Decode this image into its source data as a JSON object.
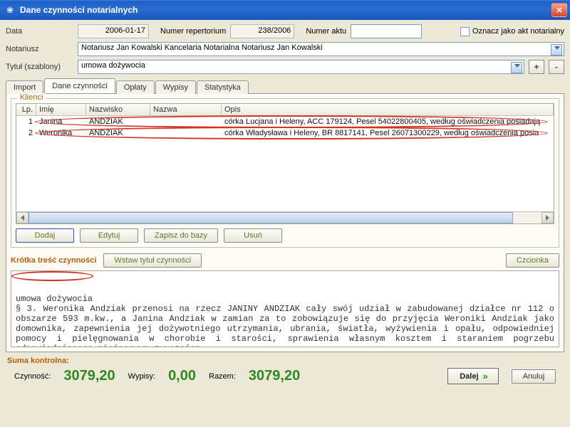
{
  "window": {
    "title": "Dane czynności notarialnych"
  },
  "labels": {
    "data": "Data",
    "numer_repertorium": "Numer repertorium",
    "numer_aktu": "Numer aktu",
    "oznacz_akt": "Oznacz jako akt notarialny",
    "notariusz": "Notariusz",
    "tytul": "Tytuł (szablony)",
    "plus": "+",
    "minus": "-"
  },
  "values": {
    "data": "2006-01-17",
    "numer_repertorium": "238/2006",
    "numer_aktu": "",
    "notariusz": "Notariusz Jan Kowalski Kancelaria Notarialna Notariusz Jan Kowalski",
    "tytul": "umowa dożywocia"
  },
  "tabs": {
    "import": "Import",
    "dane": "Dane czynności",
    "oplaty": "Opłaty",
    "wypisy": "Wypisy",
    "statystyka": "Statystyka"
  },
  "klienci": {
    "title": "Klienci",
    "headers": {
      "lp": "Lp.",
      "imie": "Imię",
      "nazwisko": "Nazwisko",
      "nazwa": "Nazwa",
      "opis": "Opis"
    },
    "rows": [
      {
        "lp": "1",
        "imie": "Janina",
        "nazwisko": "ANDZIAK",
        "nazwa": "",
        "opis": "córka Lucjana i Heleny, ACC 179124, Pesel 54022800405, według oświadczenia posiadają"
      },
      {
        "lp": "2",
        "imie": "Weronika",
        "nazwisko": "ANDZIAK",
        "nazwa": "",
        "opis": "córka Władysława i Heleny, BR 8817141, Pesel 26071300229, według oświadczenia posia"
      }
    ],
    "buttons": {
      "dodaj": "Dodaj",
      "edytuj": "Edytuj",
      "zapisz": "Zapisz do bazy",
      "usun": "Usuń"
    }
  },
  "tresc": {
    "title": "Krótka treść czynności",
    "wstaw": "Wstaw tytuł czynności",
    "czcionka": "Czcionka",
    "text": "umowa dożywocia\n§ 3. Weronika Andziak przenosi na rzecz JANINY ANDZIAK cały swój udział w zabudowanej działce nr 112 o obszarze 593 m.kw., a Janina Andziak w zamian za to zobowiązuje się do przyjęcia Weroniki Andziak jako domownika, zapewnienia jej dożywotniego utrzymania, ubrania, światła, wyżywienia i opału, odpowiedniej pomocy i pielęgnowania w chorobie i starości, sprawienia własnym kosztem i staraniem pogrzebu odpowiadającego miejscowym zwyczajom."
  },
  "suma": {
    "title": "Suma kontrolna:",
    "czynnosc_label": "Czynność:",
    "wypisy_label": "Wypisy:",
    "razem_label": "Razem:",
    "czynnosc": "3079,20",
    "wypisy": "0,00",
    "razem": "3079,20"
  },
  "nav": {
    "dalej": "Dalej",
    "anuluj": "Anuluj"
  }
}
